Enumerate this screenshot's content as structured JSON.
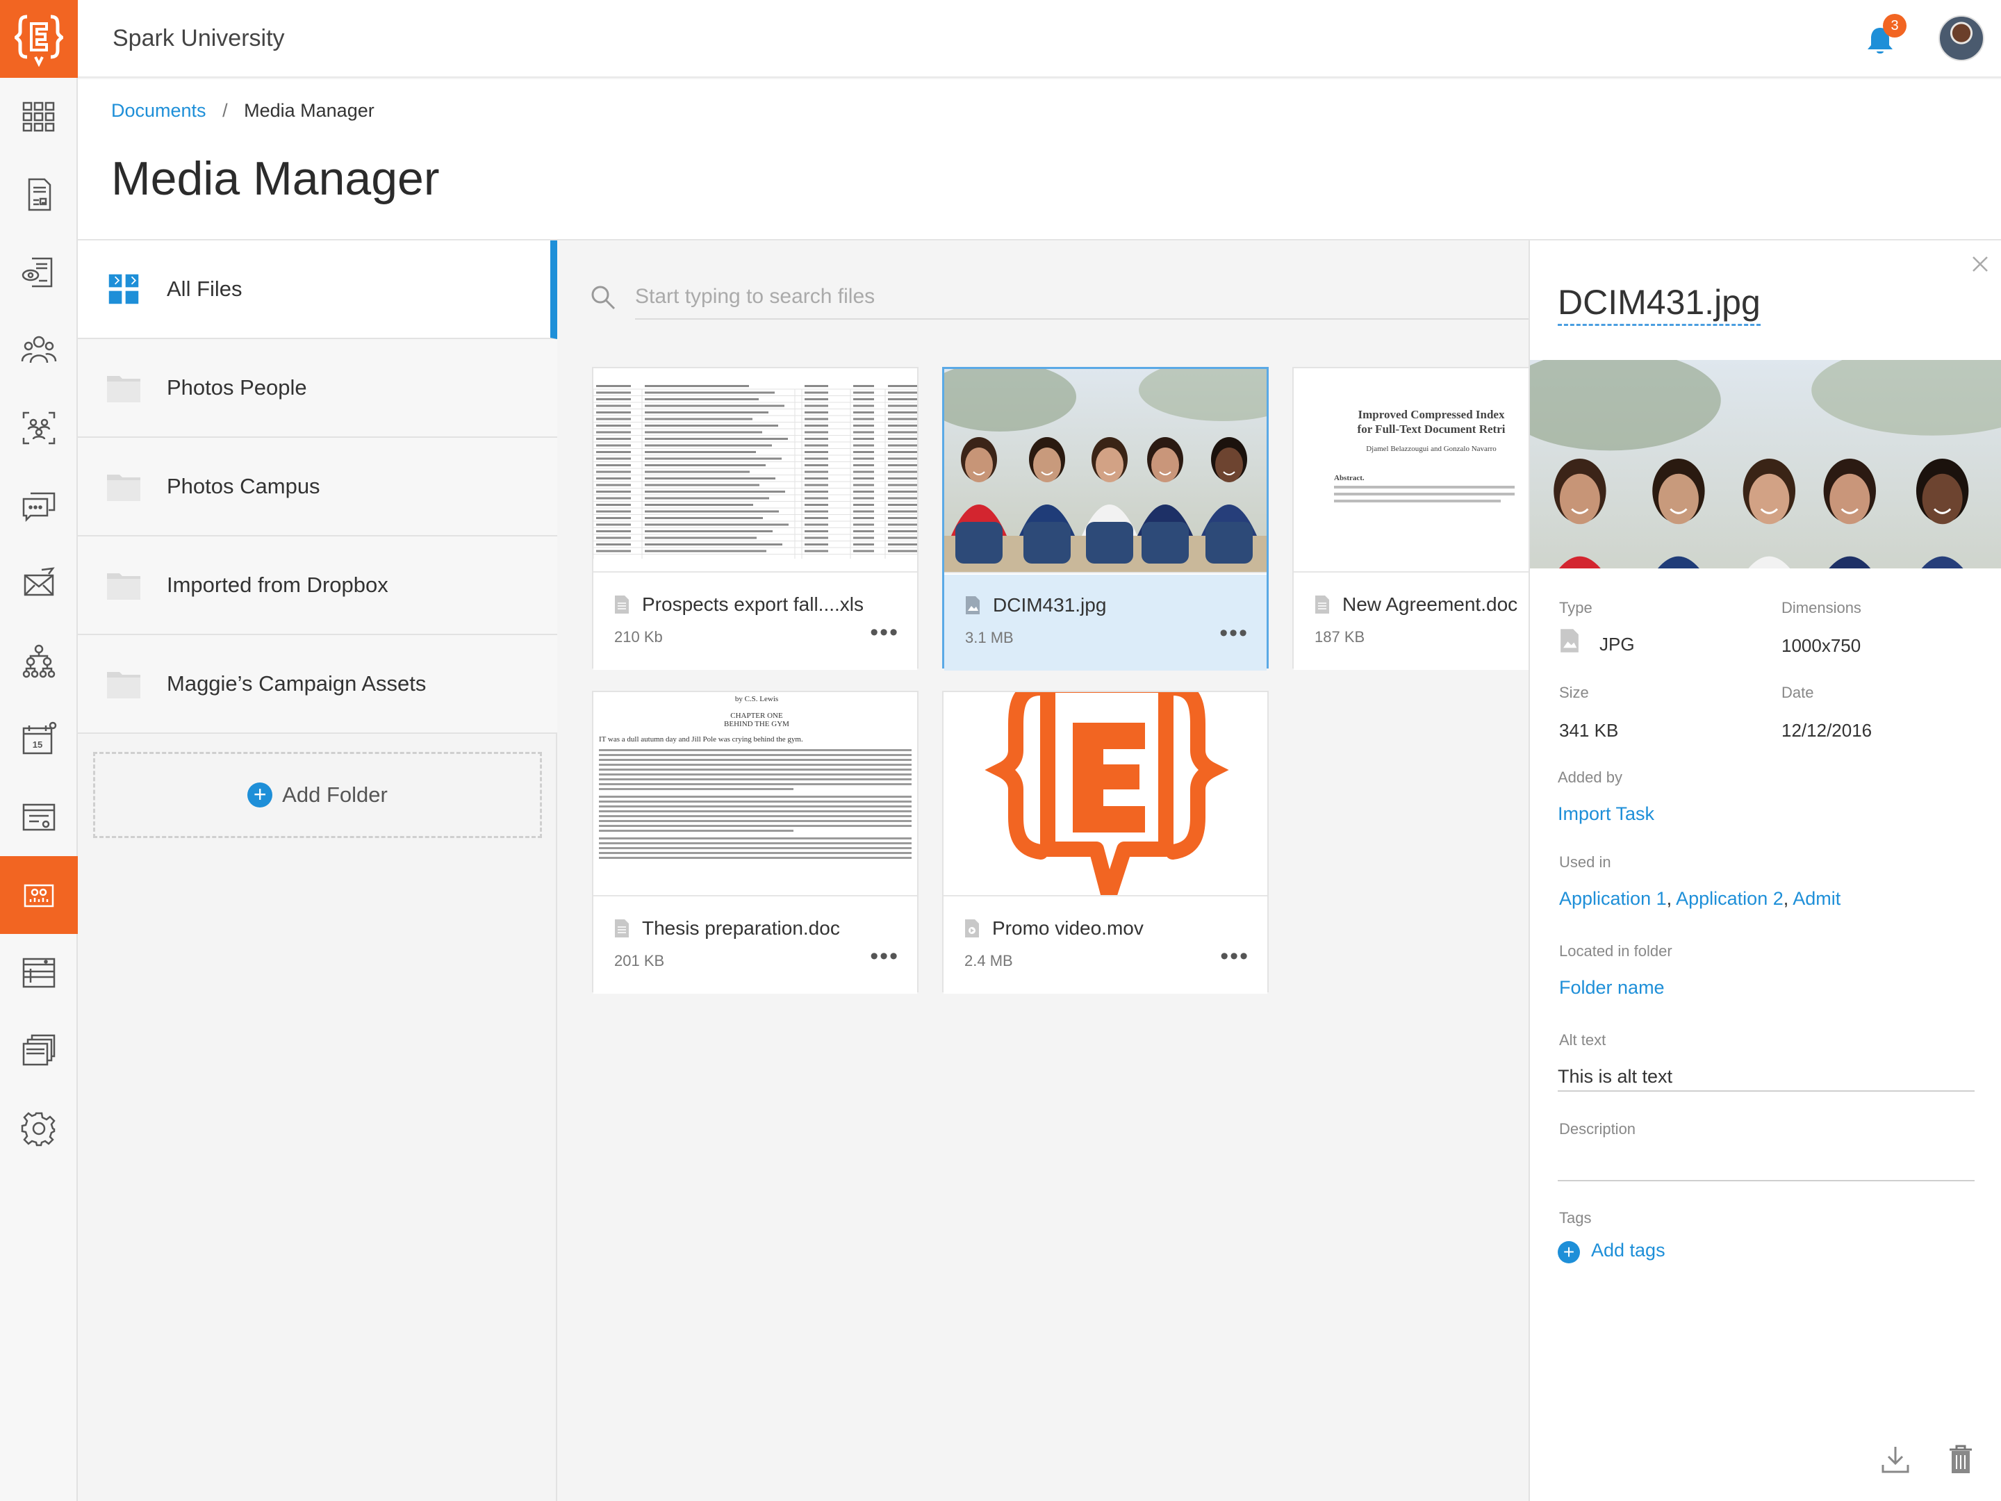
{
  "app": {
    "org_name": "Spark University",
    "notification_count": "3",
    "accent_color": "#f26522",
    "link_color": "#1e8fd8"
  },
  "breadcrumb": {
    "parent": "Documents",
    "separator": "/",
    "current": "Media Manager"
  },
  "page_title": "Media Manager",
  "folders": {
    "items": [
      {
        "label": "All Files",
        "icon": "grid-icon"
      },
      {
        "label": "Photos People",
        "icon": "folder-icon"
      },
      {
        "label": "Photos Campus",
        "icon": "folder-icon"
      },
      {
        "label": "Imported from Dropbox",
        "icon": "folder-icon"
      },
      {
        "label": "Maggie’s Campaign Assets",
        "icon": "folder-icon"
      }
    ],
    "add_label": "Add Folder"
  },
  "search": {
    "placeholder": "Start typing to search files"
  },
  "files": [
    {
      "name": "Prospects export fall....xls",
      "size": "210 Kb",
      "more": "•••"
    },
    {
      "name": "DCIM431.jpg",
      "size": "3.1 MB",
      "more": "•••"
    },
    {
      "name": "New Agreement.doc",
      "size": "187 KB",
      "more": "•••"
    },
    {
      "name": "Thesis preparation.doc",
      "size": "201 KB",
      "more": "•••"
    },
    {
      "name": "Promo video.mov",
      "size": "2.4 MB",
      "more": "•••"
    }
  ],
  "previews": {
    "doc_title": "Improved Compressed Index\nfor Full-Text Document Retri",
    "doc_authors": "Djamel Belazzougui and Gonzalo Navarro",
    "doc_abstract_label": "Abstract.",
    "thesis_author": "by C.S. Lewis",
    "thesis_chapter": "CHAPTER ONE",
    "thesis_chapter_title": "BEHIND THE GYM",
    "thesis_first_line": "IT was a dull autumn day and Jill Pole was crying behind the gym."
  },
  "details": {
    "title": "DCIM431.jpg",
    "type_label": "Type",
    "type_value": "JPG",
    "dimensions_label": "Dimensions",
    "dimensions_value": "1000x750",
    "size_label": "Size",
    "size_value": "341 KB",
    "date_label": "Date",
    "date_value": "12/12/2016",
    "added_by_label": "Added by",
    "added_by_value": "Import Task",
    "used_in_label": "Used in",
    "used_in": [
      "Application 1",
      "Application 2",
      "Admit"
    ],
    "folder_label": "Located in folder",
    "folder_value": "Folder name",
    "alt_label": "Alt text",
    "alt_value": "This is alt text",
    "description_label": "Description",
    "description_value": "",
    "tags_label": "Tags",
    "tags_add": "Add tags"
  }
}
